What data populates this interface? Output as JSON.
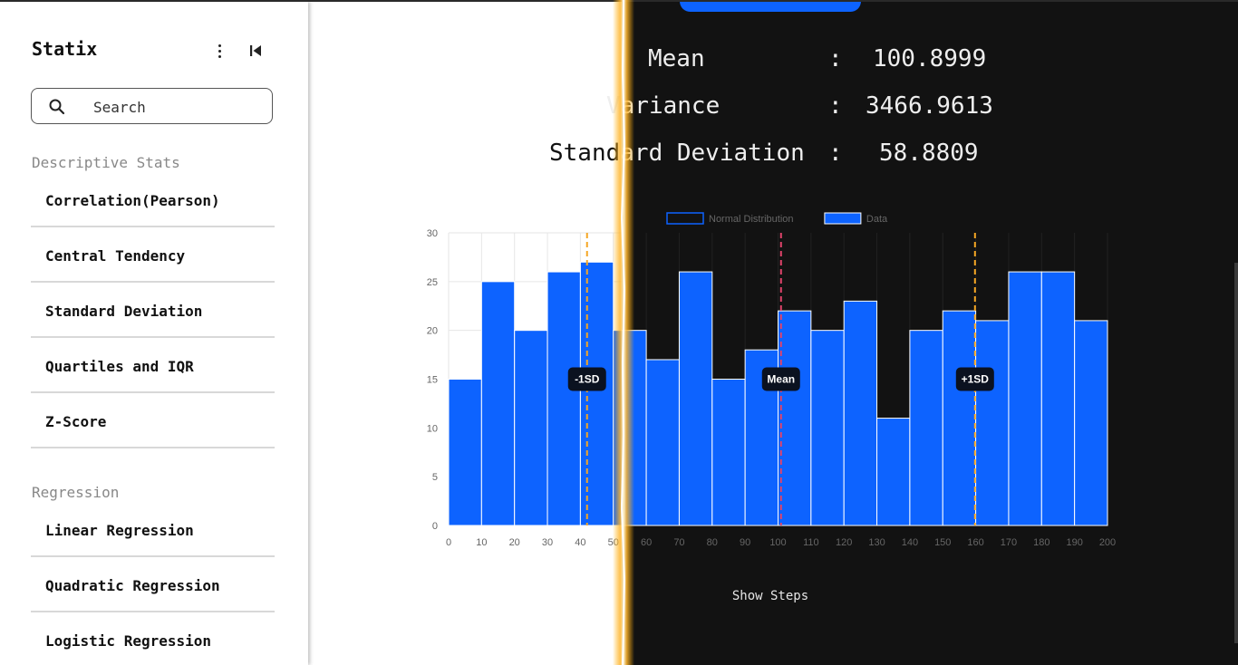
{
  "app": {
    "title": "Statix"
  },
  "sidebar": {
    "search_placeholder": "Search",
    "sections": [
      {
        "title": "Descriptive Stats",
        "items": [
          "Correlation(Pearson)",
          "Central Tendency",
          "Standard Deviation",
          "Quartiles and IQR",
          "Z-Score"
        ]
      },
      {
        "title": "Regression",
        "items": [
          "Linear Regression",
          "Quadratic Regression",
          "Logistic Regression"
        ]
      }
    ]
  },
  "results": {
    "mean": {
      "label": "Mean",
      "sep": ":",
      "value": "100.8999"
    },
    "variance": {
      "label": "Variance",
      "sep": ":",
      "value": "3466.9613"
    },
    "sd": {
      "label": "Standard Deviation",
      "sep": ":",
      "value": "58.8809"
    }
  },
  "actions": {
    "show_steps": "Show Steps"
  },
  "colors": {
    "accent": "#0d63ff",
    "bar_fill": "#0d63ff",
    "mean_line": "#e0436b",
    "sd_line": "#f5a623",
    "dark_bg": "#121212",
    "legend_text": "#666666"
  },
  "icons": {
    "menu": "kebab-icon",
    "collapse": "collapse-left-icon",
    "search": "search-icon"
  },
  "chart_data": {
    "type": "bar",
    "legend": [
      {
        "name": "Normal Distribution",
        "style": "outline"
      },
      {
        "name": "Data",
        "style": "filled"
      }
    ],
    "legend_position": "top-center",
    "x_ticks": [
      0,
      10,
      20,
      30,
      40,
      50,
      60,
      70,
      80,
      90,
      100,
      110,
      120,
      130,
      140,
      150,
      160,
      170,
      180,
      190,
      200
    ],
    "y_ticks": [
      0,
      5,
      10,
      15,
      20,
      25,
      30
    ],
    "xlim": [
      0,
      200
    ],
    "ylim": [
      0,
      30
    ],
    "bin_width": 10,
    "series": [
      {
        "name": "Data",
        "bin_starts": [
          0,
          10,
          20,
          30,
          40,
          50,
          60,
          70,
          80,
          90,
          100,
          110,
          120,
          130,
          140,
          150,
          160,
          170,
          180,
          190
        ],
        "values": [
          15,
          25,
          20,
          26,
          27,
          20,
          17,
          26,
          15,
          18,
          22,
          20,
          23,
          11,
          20,
          22,
          21,
          26,
          26,
          21
        ]
      }
    ],
    "annotations": [
      {
        "label": "-1SD",
        "x": 42.02
      },
      {
        "label": "Mean",
        "x": 100.8999
      },
      {
        "label": "+1SD",
        "x": 159.78
      }
    ],
    "grid": true
  }
}
